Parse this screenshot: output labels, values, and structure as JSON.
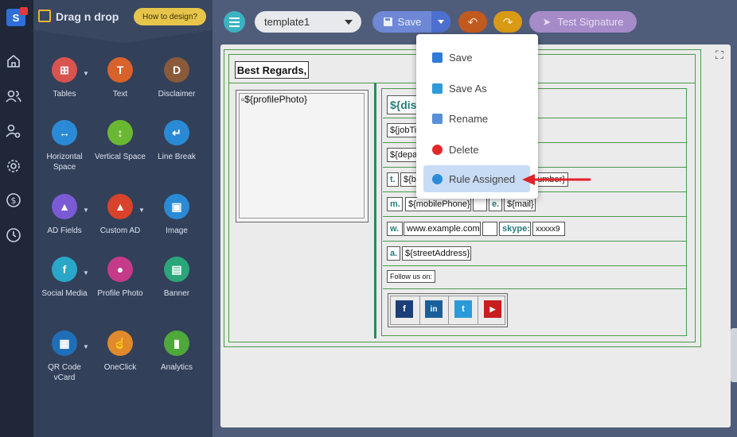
{
  "sidebar": {
    "title": "Drag n drop",
    "how_button": "How to design?",
    "components": [
      {
        "label": "Tables",
        "icon": "table-icon",
        "color": "#d9534f",
        "caret": true
      },
      {
        "label": "Text",
        "icon": "text-icon",
        "color": "#d9622b",
        "caret": false
      },
      {
        "label": "Disclaimer",
        "icon": "disclaimer-icon",
        "color": "#8a5a3a",
        "caret": false
      },
      {
        "label": "Horizontal Space",
        "icon": "horizontal-space-icon",
        "color": "#2a8ad6",
        "caret": false
      },
      {
        "label": "Vertical Space",
        "icon": "vertical-space-icon",
        "color": "#6ab832",
        "caret": false
      },
      {
        "label": "Line Break",
        "icon": "line-break-icon",
        "color": "#2a8ad6",
        "caret": false
      },
      {
        "label": "AD Fields",
        "icon": "ad-fields-icon",
        "color": "#7b5ad6",
        "caret": true
      },
      {
        "label": "Custom AD",
        "icon": "custom-ad-icon",
        "color": "#d9422b",
        "caret": true
      },
      {
        "label": "Image",
        "icon": "image-icon",
        "color": "#2a8ad6",
        "caret": false
      },
      {
        "label": "Social Media",
        "icon": "social-media-icon",
        "color": "#2aa6c8",
        "caret": true
      },
      {
        "label": "Profile Photo",
        "icon": "profile-photo-icon",
        "color": "#c63a8a",
        "caret": false
      },
      {
        "label": "Banner",
        "icon": "banner-icon",
        "color": "#2aa67a",
        "caret": false
      },
      {
        "label": "QR Code vCard",
        "icon": "qr-code-icon",
        "color": "#1f6fb8",
        "caret": true
      },
      {
        "label": "OneClick",
        "icon": "oneclick-icon",
        "color": "#e08a2b",
        "caret": false
      },
      {
        "label": "Analytics",
        "icon": "analytics-icon",
        "color": "#4fa83a",
        "caret": false
      }
    ]
  },
  "toolbar": {
    "template_value": "template1",
    "save_label": "Save",
    "undo_icon": "undo-icon",
    "redo_icon": "redo-icon",
    "test_label": "Test Signature"
  },
  "dropdown": {
    "items": [
      {
        "label": "Save",
        "icon": "save-icon",
        "color": "#2e7bd8"
      },
      {
        "label": "Save As",
        "icon": "save-as-icon",
        "color": "#2e9bd8"
      },
      {
        "label": "Rename",
        "icon": "rename-icon",
        "color": "#5a8fd8"
      },
      {
        "label": "Delete",
        "icon": "delete-icon",
        "color": "#e02a2a"
      },
      {
        "label": "Rule Assigned",
        "icon": "gear-icon",
        "color": "#2e8bd8"
      }
    ]
  },
  "signature": {
    "greeting": "Best Regards,",
    "photo": "${profilePhoto}",
    "display": "${dis",
    "job": "${jobTi",
    "dept": "${depa",
    "t_label": "t.",
    "t_value": "${bu",
    "t_right": "umber}",
    "m_label": "m.",
    "mobile": "${mobilePhone}",
    "e_label": "e.",
    "mail": "${mail}",
    "w_label": "w.",
    "website": "www.example.com",
    "skype_label": "skype:",
    "skype": "xxxxx9",
    "a_label": "a.",
    "address": "${streetAddress}",
    "follow": "Follow us on:",
    "social": [
      "f",
      "in",
      "t",
      "▶"
    ]
  }
}
